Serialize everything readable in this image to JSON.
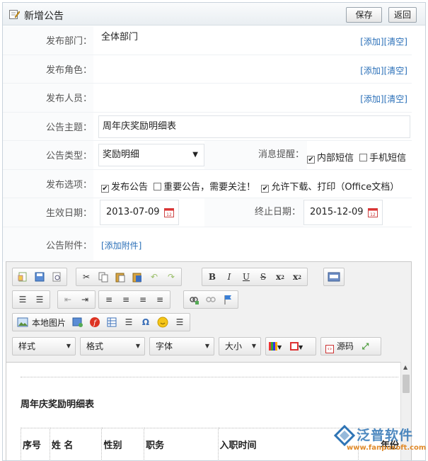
{
  "header": {
    "title": "新增公告",
    "save_label": "保存",
    "back_label": "返回"
  },
  "form": {
    "department": {
      "label": "发布部门：",
      "value": "全体部门",
      "add": "[添加]",
      "clear": "[清空]"
    },
    "role": {
      "label": "发布角色：",
      "value": "",
      "add": "[添加]",
      "clear": "[清空]"
    },
    "person": {
      "label": "发布人员：",
      "value": "",
      "add": "[添加]",
      "clear": "[清空]"
    },
    "subject": {
      "label": "公告主题：",
      "value": "周年庆奖励明细表"
    },
    "type": {
      "label": "公告类型：",
      "value": "奖励明细",
      "remind_label": "消息提醒：",
      "internal_sms": "内部短信",
      "mobile_sms": "手机短信",
      "internal_checked": true,
      "mobile_checked": false
    },
    "options": {
      "label": "发布选项：",
      "publish": "发布公告",
      "important": "重要公告，需要关注！",
      "allow": "允许下载、打印（Office文档）",
      "publish_checked": true,
      "important_checked": false,
      "allow_checked": true
    },
    "dates": {
      "start_label": "生效日期：",
      "start": "2013-07-09",
      "end_label": "终止日期：",
      "end": "2015-12-09"
    },
    "attachment": {
      "label": "公告附件：",
      "add": "[添加附件]"
    }
  },
  "editor": {
    "local_image": "本地图片",
    "style": "样式",
    "format": "格式",
    "font": "字体",
    "size": "大小",
    "source": "源码",
    "content_title": "周年庆奖励明细表",
    "columns": [
      "序号",
      "姓 名",
      "性别",
      "职务",
      "入职时间",
      "年份"
    ]
  },
  "watermark": {
    "name": "泛普软件",
    "url": "www.fanpusoft.com"
  },
  "colors": {
    "link": "#2a6fb8",
    "brand": "#2e74b5"
  }
}
